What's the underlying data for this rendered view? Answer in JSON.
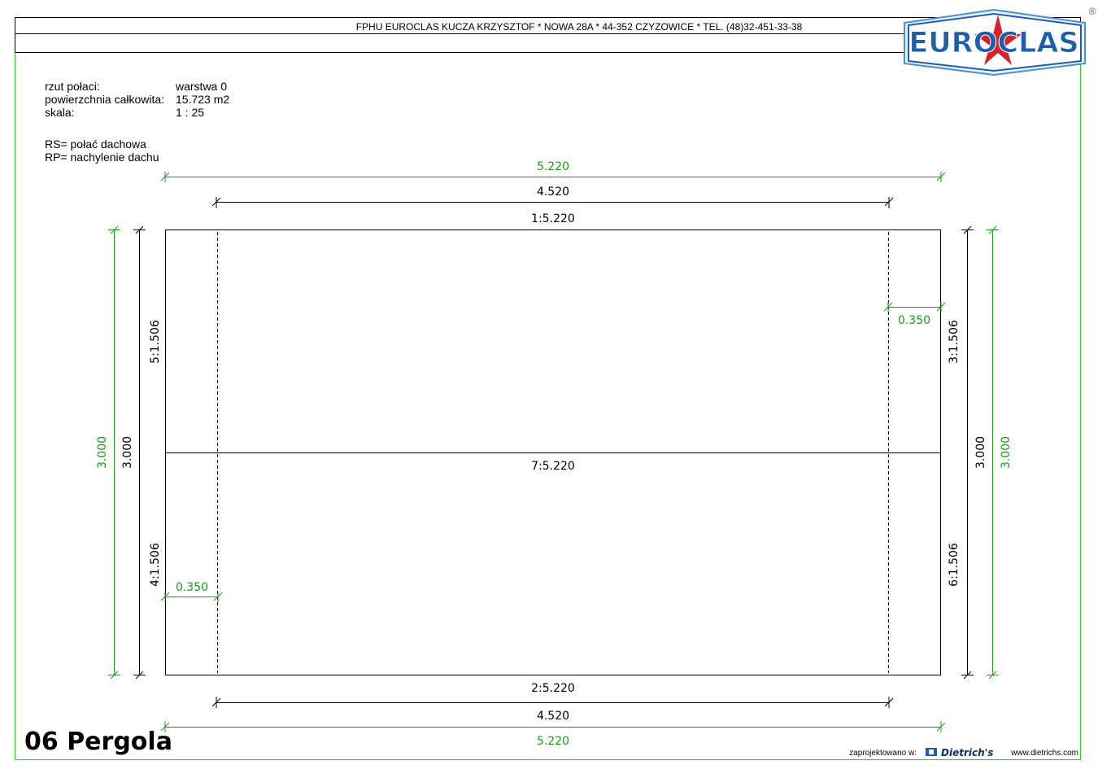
{
  "header": {
    "company_line": "FPHU EUROCLAS KUCZA KRZYSZTOF * NOWA 28A * 44-352 CZYZOWICE * TEL. (48)32-451-33-38",
    "logo_text": "EUROCLAS",
    "registered_mark": "®"
  },
  "info": {
    "rows": [
      {
        "label": "rzut połaci:",
        "value": "warstwa 0"
      },
      {
        "label": "powierzchnia całkowita:",
        "value": "15.723 m2"
      },
      {
        "label": "skala:",
        "value": "1 : 25"
      }
    ],
    "legend": [
      "RS= połać dachowa",
      "RP= nachylenie dachu"
    ]
  },
  "dimensions": {
    "top_overall": "5.220",
    "top_inner": "4.520",
    "top_edge": "1:5.220",
    "middle_line": "7:5.220",
    "bottom_edge": "2:5.220",
    "bottom_inner": "4.520",
    "bottom_overall": "5.220",
    "left_upper": "5:1.506",
    "left_lower": "4:1.506",
    "right_upper": "3:1.506",
    "right_lower": "6:1.506",
    "left_height_black": "3.000",
    "left_height_green": "3.000",
    "right_height_black": "3.000",
    "right_height_green": "3.000",
    "overhang_left": "0.350",
    "overhang_right": "0.350"
  },
  "colors": {
    "green": "#1a9a1a",
    "frame_green": "#33cc33",
    "logo_blue": "#1d5fa8",
    "logo_red": "#d6222a"
  },
  "footer": {
    "title": "06 Pergola",
    "designed_in_label": "zaprojektowano w:",
    "software_name": "Dietrich's",
    "website": "www.dietrichs.com"
  }
}
